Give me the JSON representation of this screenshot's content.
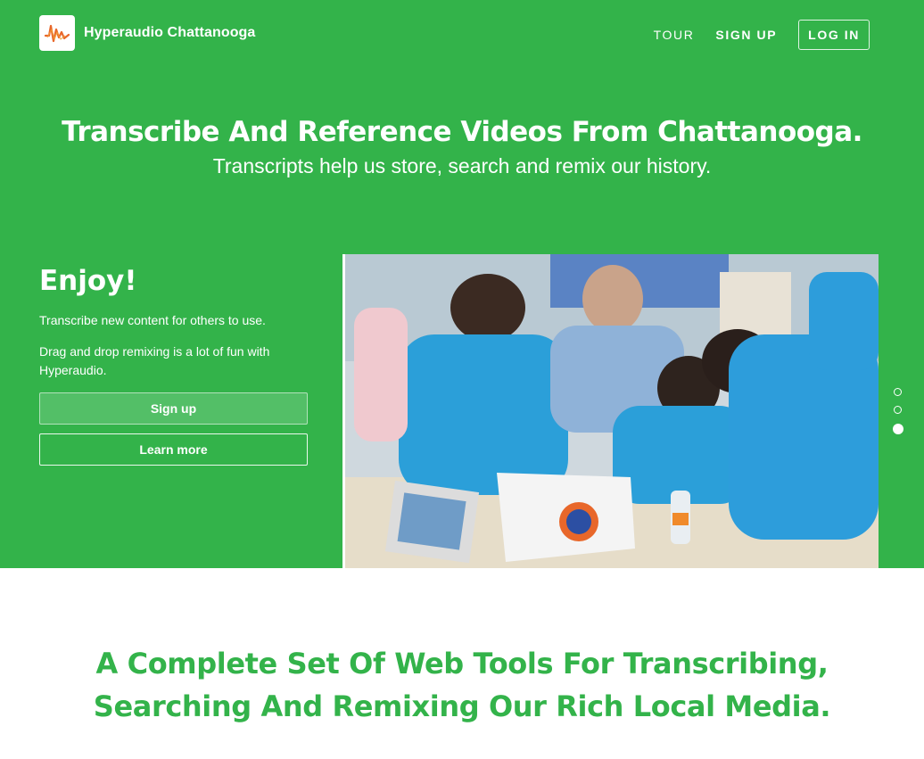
{
  "header": {
    "brand": "Hyperaudio Chattanooga",
    "logo_icon": "waveform-logo-icon",
    "nav": {
      "tour": "TOUR",
      "signup": "SIGN UP",
      "login": "LOG IN"
    }
  },
  "hero": {
    "title": "Transcribe And Reference Videos From Chattanooga.",
    "subtitle": "Transcripts help us store, search and remix our history."
  },
  "panel": {
    "heading": "Enjoy!",
    "paragraphs": [
      "Transcribe new content for others to use.",
      "Drag and drop remixing is a lot of fun with Hyperaudio."
    ],
    "signup_button": "Sign up",
    "learn_more_button": "Learn more"
  },
  "slideshow": {
    "slide_count": 3,
    "active_slide": 3
  },
  "features": {
    "title_line1": "A Complete Set Of Web Tools For Transcribing,",
    "title_line2": "Searching And Remixing Our Rich Local Media."
  },
  "colors": {
    "brand_green": "#33b34a",
    "white": "#ffffff",
    "logo_wave": "#e8672a"
  }
}
